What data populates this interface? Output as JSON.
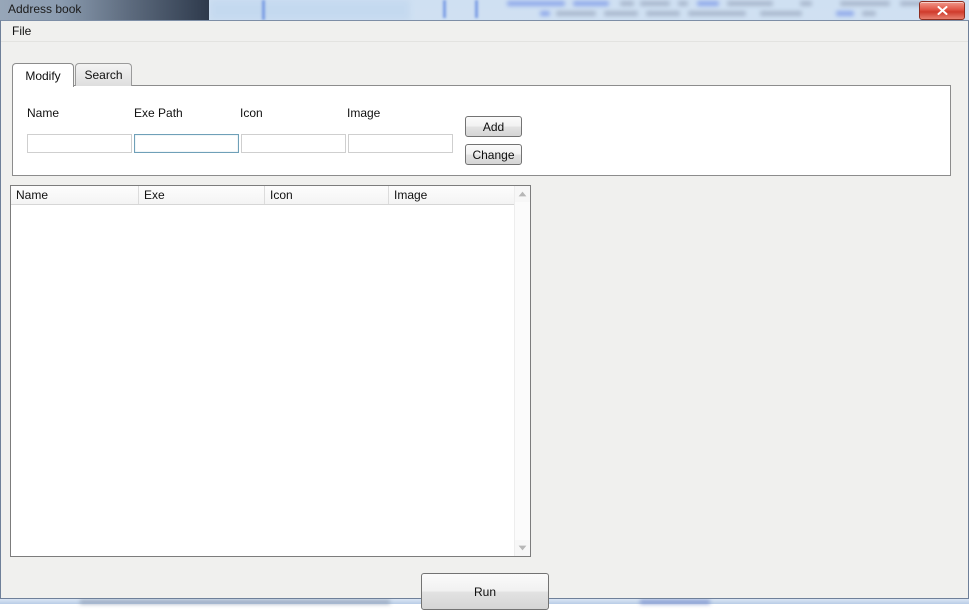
{
  "window": {
    "title": "Address book",
    "close_icon": "close-x-icon"
  },
  "menubar": {
    "items": [
      {
        "label": "File"
      }
    ]
  },
  "tabs": [
    {
      "label": "Modify",
      "active": true
    },
    {
      "label": "Search",
      "active": false
    }
  ],
  "form": {
    "fields": [
      {
        "label": "Name",
        "value": "",
        "placeholder": "",
        "focused": false
      },
      {
        "label": "Exe Path",
        "value": "",
        "placeholder": "",
        "focused": true
      },
      {
        "label": "Icon",
        "value": "",
        "placeholder": "",
        "focused": false
      },
      {
        "label": "Image",
        "value": "",
        "placeholder": "",
        "focused": false
      }
    ],
    "buttons": [
      {
        "label": "Add"
      },
      {
        "label": "Change"
      }
    ]
  },
  "table": {
    "columns": [
      {
        "label": "Name"
      },
      {
        "label": "Exe"
      },
      {
        "label": "Icon"
      },
      {
        "label": "Image"
      }
    ],
    "rows": [],
    "scrollbar": {
      "up_icon": "scroll-up-arrow-icon",
      "down_icon": "scroll-down-arrow-icon"
    }
  },
  "footer": {
    "run_label": "Run"
  },
  "colors": {
    "window_chrome": "#f0f0ee",
    "accent_focus_border": "#6fa0b8",
    "close_button": "#cf3b2c",
    "desktop": "#d9e7f5"
  }
}
